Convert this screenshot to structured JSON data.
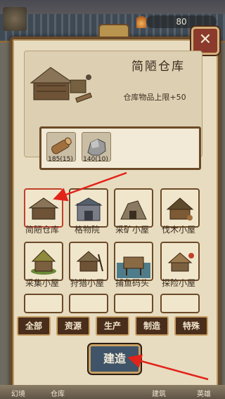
{
  "top_bar": {
    "counter_value": "80"
  },
  "dialog": {
    "close_label": "✕",
    "title": "简陋仓库",
    "effect": "仓库物品上限+50",
    "costs": [
      {
        "icon": "wood-log-icon",
        "amount": "185(15)"
      },
      {
        "icon": "stone-icon",
        "amount": "140(10)"
      }
    ],
    "buildings": [
      {
        "label": "简陋仓库",
        "selected": true
      },
      {
        "label": "格物院"
      },
      {
        "label": "采矿小屋"
      },
      {
        "label": "伐木小屋"
      },
      {
        "label": "采集小屋"
      },
      {
        "label": "狩猎小屋"
      },
      {
        "label": "捕鱼码头"
      },
      {
        "label": "探险小屋"
      }
    ],
    "filters": [
      "全部",
      "资源",
      "生产",
      "制造",
      "特殊"
    ],
    "build_button": "建造"
  },
  "bottom_nav": [
    "幻境",
    "仓库",
    "建筑",
    "英雄"
  ],
  "colors": {
    "frame_brown": "#6b4a28",
    "parchment": "#e8dcc0",
    "arrow_red": "#e2231a",
    "build_blue": "#3f5468"
  }
}
